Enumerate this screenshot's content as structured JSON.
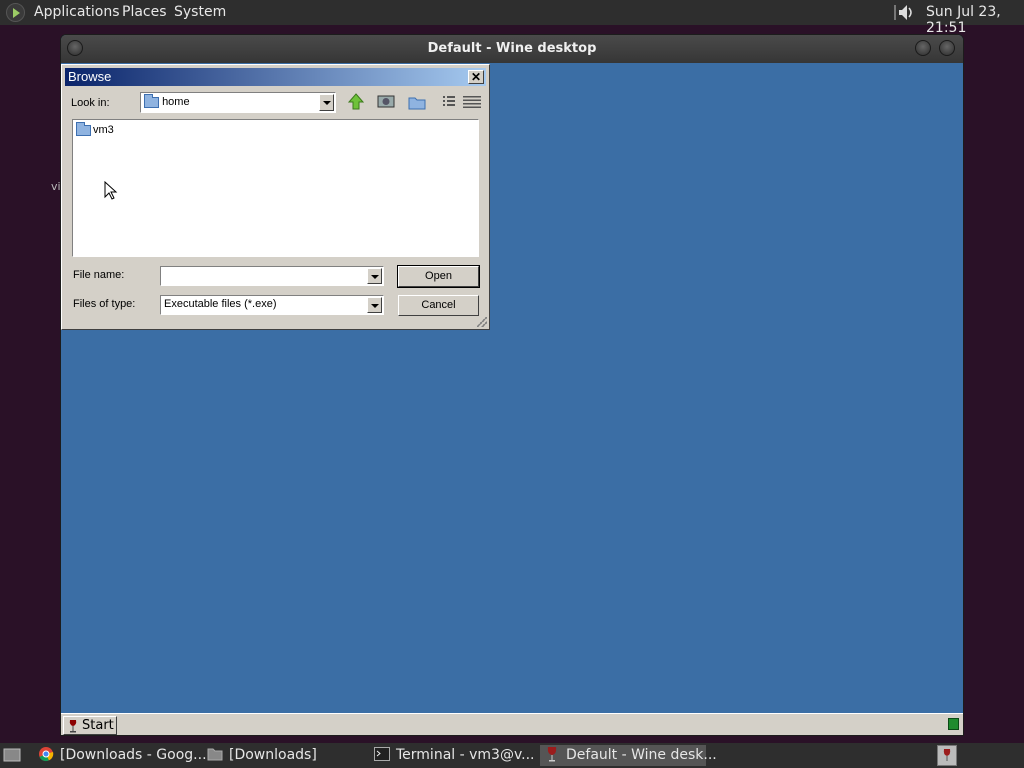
{
  "top_panel": {
    "menus": [
      "Applications",
      "Places",
      "System"
    ],
    "clock": "Sun Jul 23, 21:51"
  },
  "desktop_text": "vi",
  "wine_window": {
    "title": "Default - Wine desktop",
    "start_label": "Start"
  },
  "browse_dialog": {
    "title": "Browse",
    "close_glyph": "✕",
    "look_in_label": "Look in:",
    "look_in_value": "home",
    "files": [
      {
        "name": "vm3",
        "type": "folder"
      }
    ],
    "file_name_label": "File name:",
    "file_name_value": "",
    "files_of_type_label": "Files of type:",
    "files_of_type_value": "Executable files (*.exe)",
    "open_label": "Open",
    "cancel_label": "Cancel"
  },
  "bottom_taskbar": {
    "tasks": [
      {
        "label": "[Downloads - Goog...",
        "icon": "chrome-icon",
        "active": false
      },
      {
        "label": "[Downloads]",
        "icon": "folder-icon",
        "active": false
      },
      {
        "label": "Terminal - vm3@v...",
        "icon": "terminal-icon",
        "active": false
      },
      {
        "label": "Default - Wine desk...",
        "icon": "wine-icon",
        "active": true
      }
    ]
  }
}
